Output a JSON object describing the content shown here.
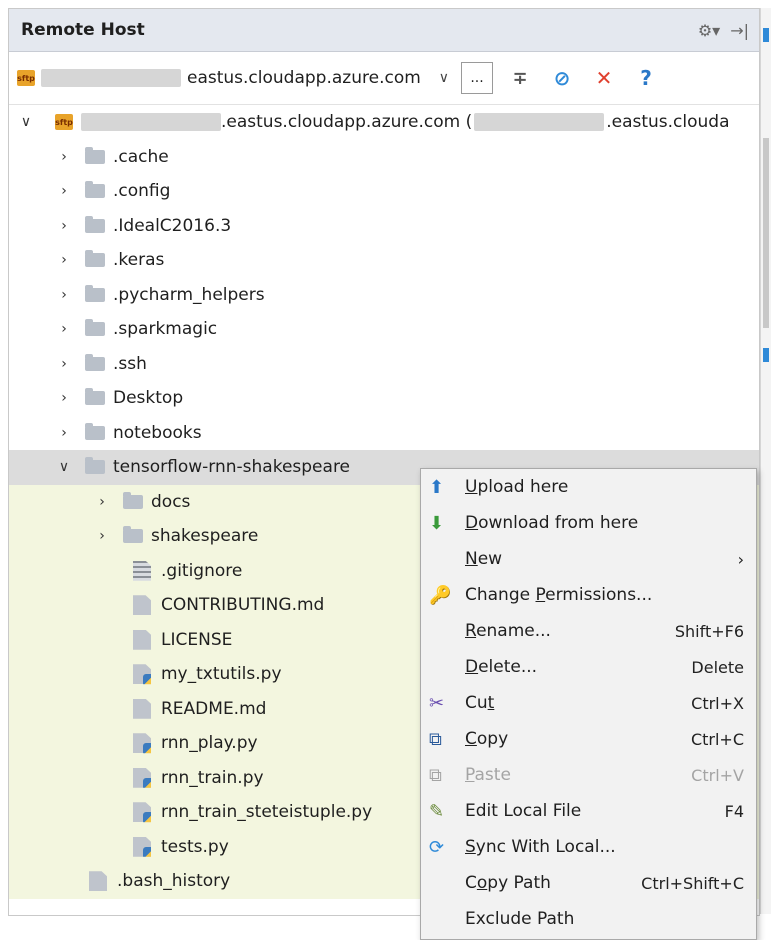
{
  "panel": {
    "title": "Remote Host"
  },
  "header_icons": {
    "settings": "⚙▾",
    "hide": "→|"
  },
  "toolbar": {
    "host_suffix": "eastus.cloudapp.azure.com",
    "more_label": "...",
    "sftp_label": "sftp"
  },
  "tree": {
    "root_label": ".eastus.cloudapp.azure.com (",
    "root_label_tail": ".eastus.clouda",
    "top_folders": [
      ".cache",
      ".config",
      ".IdealC2016.3",
      ".keras",
      ".pycharm_helpers",
      ".sparkmagic",
      ".ssh",
      "Desktop",
      "notebooks"
    ],
    "open_folder": "tensorflow-rnn-shakespeare",
    "subfolders": [
      "docs",
      "shakespeare"
    ],
    "files": [
      {
        "name": ".gitignore",
        "type": "txt"
      },
      {
        "name": "CONTRIBUTING.md",
        "type": "q"
      },
      {
        "name": "LICENSE",
        "type": "q"
      },
      {
        "name": "my_txtutils.py",
        "type": "py"
      },
      {
        "name": "README.md",
        "type": "q"
      },
      {
        "name": "rnn_play.py",
        "type": "py"
      },
      {
        "name": "rnn_train.py",
        "type": "py"
      },
      {
        "name": "rnn_train_steteistuple.py",
        "type": "py"
      },
      {
        "name": "tests.py",
        "type": "py"
      }
    ],
    "trailing": ".bash_history"
  },
  "menu": {
    "upload": {
      "pre": "",
      "u": "U",
      "post": "pload here"
    },
    "download": {
      "pre": "",
      "u": "D",
      "post": "ownload from here"
    },
    "new": {
      "pre": "",
      "u": "N",
      "post": "ew",
      "arrow": "›"
    },
    "permissions": {
      "pre": "Change ",
      "u": "P",
      "post": "ermissions..."
    },
    "rename": {
      "pre": "",
      "u": "R",
      "post": "ename...",
      "shortcut": "Shift+F6"
    },
    "delete": {
      "pre": "",
      "u": "D",
      "post": "elete...",
      "shortcut": "Delete"
    },
    "cut": {
      "pre": "Cu",
      "u": "t",
      "post": "",
      "shortcut": "Ctrl+X"
    },
    "copy": {
      "pre": "",
      "u": "C",
      "post": "opy",
      "shortcut": "Ctrl+C"
    },
    "paste": {
      "pre": "",
      "u": "P",
      "post": "aste",
      "shortcut": "Ctrl+V"
    },
    "edit_local": {
      "label": "Edit Local File",
      "shortcut": "F4"
    },
    "sync": {
      "pre": "",
      "u": "S",
      "post": "ync With Local..."
    },
    "copy_path": {
      "pre": "C",
      "u": "o",
      "post": "py Path",
      "shortcut": "Ctrl+Shift+C"
    },
    "exclude": {
      "label": "Exclude Path"
    }
  },
  "colors": {
    "sync_icon": "#2f8ad8",
    "close_icon": "#e0402e",
    "help_icon": "#2a78c8",
    "highlight_bg": "#f3f6df"
  }
}
